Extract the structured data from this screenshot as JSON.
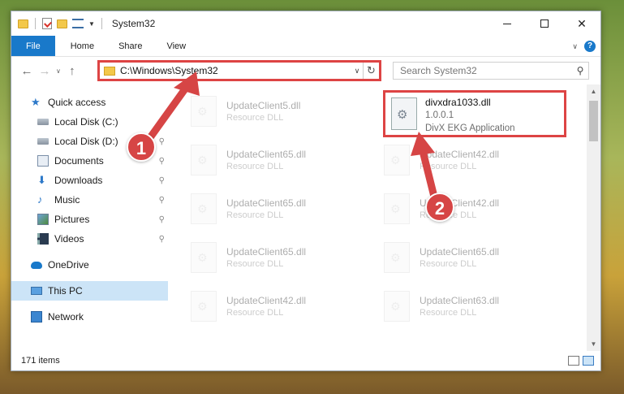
{
  "window": {
    "title": "System32",
    "minimize_icon": "minimize-icon",
    "maximize_icon": "maximize-icon",
    "close_symbol": "✕"
  },
  "ribbon": {
    "tabs": [
      "File",
      "Home",
      "Share",
      "View"
    ],
    "expand_symbol": "∨",
    "help_symbol": "?"
  },
  "nav": {
    "back": "←",
    "forward": "→",
    "up": "↑",
    "address": "C:\\Windows\\System32",
    "dropdown_symbol": "∨",
    "refresh_symbol": "↻",
    "search_placeholder": "Search System32",
    "search_icon": "⚲"
  },
  "sidebar": {
    "items": [
      {
        "label": "Quick access",
        "icon": "star-icon",
        "pinned": false
      },
      {
        "label": "Local Disk (C:)",
        "icon": "disk-icon",
        "pinned": true
      },
      {
        "label": "Local Disk (D:)",
        "icon": "disk-icon",
        "pinned": true
      },
      {
        "label": "Documents",
        "icon": "documents-icon",
        "pinned": true
      },
      {
        "label": "Downloads",
        "icon": "downloads-icon",
        "pinned": true
      },
      {
        "label": "Music",
        "icon": "music-icon",
        "pinned": true
      },
      {
        "label": "Pictures",
        "icon": "pictures-icon",
        "pinned": true
      },
      {
        "label": "Videos",
        "icon": "videos-icon",
        "pinned": true
      },
      {
        "label": "OneDrive",
        "icon": "cloud-icon"
      },
      {
        "label": "This PC",
        "icon": "computer-icon",
        "selected": true
      },
      {
        "label": "Network",
        "icon": "network-icon"
      }
    ],
    "pin_symbol": "📌"
  },
  "files": {
    "highlighted": {
      "name": "divxdra1033.dll",
      "version": "1.0.0.1",
      "description": "DivX EKG Application"
    },
    "background": [
      {
        "name": "UpdateClient5.dll",
        "type": "Resource DLL"
      },
      {
        "name": "UpdateClient65.dll",
        "type": "Resource DLL"
      },
      {
        "name": "UpdateClient42.dll",
        "type": "Resource DLL"
      },
      {
        "name": "UpdateClient65.dll",
        "type": "Resource DLL"
      },
      {
        "name": "UpdateClient42.dll",
        "type": "Resource DLL"
      },
      {
        "name": "UpdateClient65.dll",
        "type": "Resource DLL"
      },
      {
        "name": "UpdateClient65.dll",
        "type": "Resource DLL"
      },
      {
        "name": "UpdateClient42.dll",
        "type": "Resource DLL"
      },
      {
        "name": "UpdateClient63.dll",
        "type": "Resource DLL"
      }
    ]
  },
  "status": {
    "item_count": "171 items"
  },
  "callouts": [
    "1",
    "2"
  ],
  "colors": {
    "accent": "#1979ca",
    "highlight_border": "#dd4444",
    "callout": "#d64545"
  }
}
